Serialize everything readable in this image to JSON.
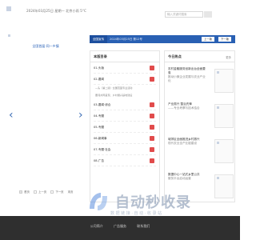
{
  "header": {
    "date_bar": "2024年03月25日  星期一  北京小雨 5°C",
    "search_placeholder": "输入关键词搜索"
  },
  "slider": {
    "caption": "全国首届·同一乡镇",
    "pager": {
      "first": "首页",
      "prev": "上一页",
      "next": "下一页",
      "last": "末页"
    }
  },
  "nav": {
    "tab": "全国宣传",
    "title": "2024年03月25日 第12号",
    "prev": "上一版",
    "next": "下一版"
  },
  "column_a": {
    "title": "本版目录",
    "items": [
      {
        "label": "01-头版"
      },
      {
        "label": "02-要闻"
      },
      {
        "label": "03-要闻·综合"
      },
      {
        "label": "04-专题"
      },
      {
        "label": "05-专题"
      },
      {
        "label": "06-新闻事"
      },
      {
        "label": "07-专题·社会"
      },
      {
        "label": "08-广告"
      }
    ],
    "subs": [
      "—头（第二版）全国范围专业活动",
      "要闻共同呈现、乡村振兴基地建设"
    ]
  },
  "column_b": {
    "title": "今日热点",
    "more": "更多",
    "items": [
      {
        "title": "农村金融服务创新出台全面要惠",
        "sub": "推动小微企业发展与农业产业化"
      },
      {
        "title": "产业振兴 整治先锋",
        "sub": "——专业考察与技术结合"
      },
      {
        "title": "城郊区全面推进乡村振兴",
        "sub": "现代农业全产业链建设"
      },
      {
        "title": "数据中心一站式乡里公共",
        "sub": "服务平台启动运营"
      }
    ]
  },
  "watermark": {
    "main": "自动秒收录",
    "sub": "数 据 链 接 · 自 动 · 收 录 站"
  },
  "footer": {
    "links": [
      "公司简介",
      "广告服务",
      "联系我们"
    ]
  },
  "colors": {
    "nav": "#2960b3",
    "nav_tab": "#1d4f9e",
    "footer": "#2f2f2f",
    "doc_icon": "#e14b4b"
  }
}
